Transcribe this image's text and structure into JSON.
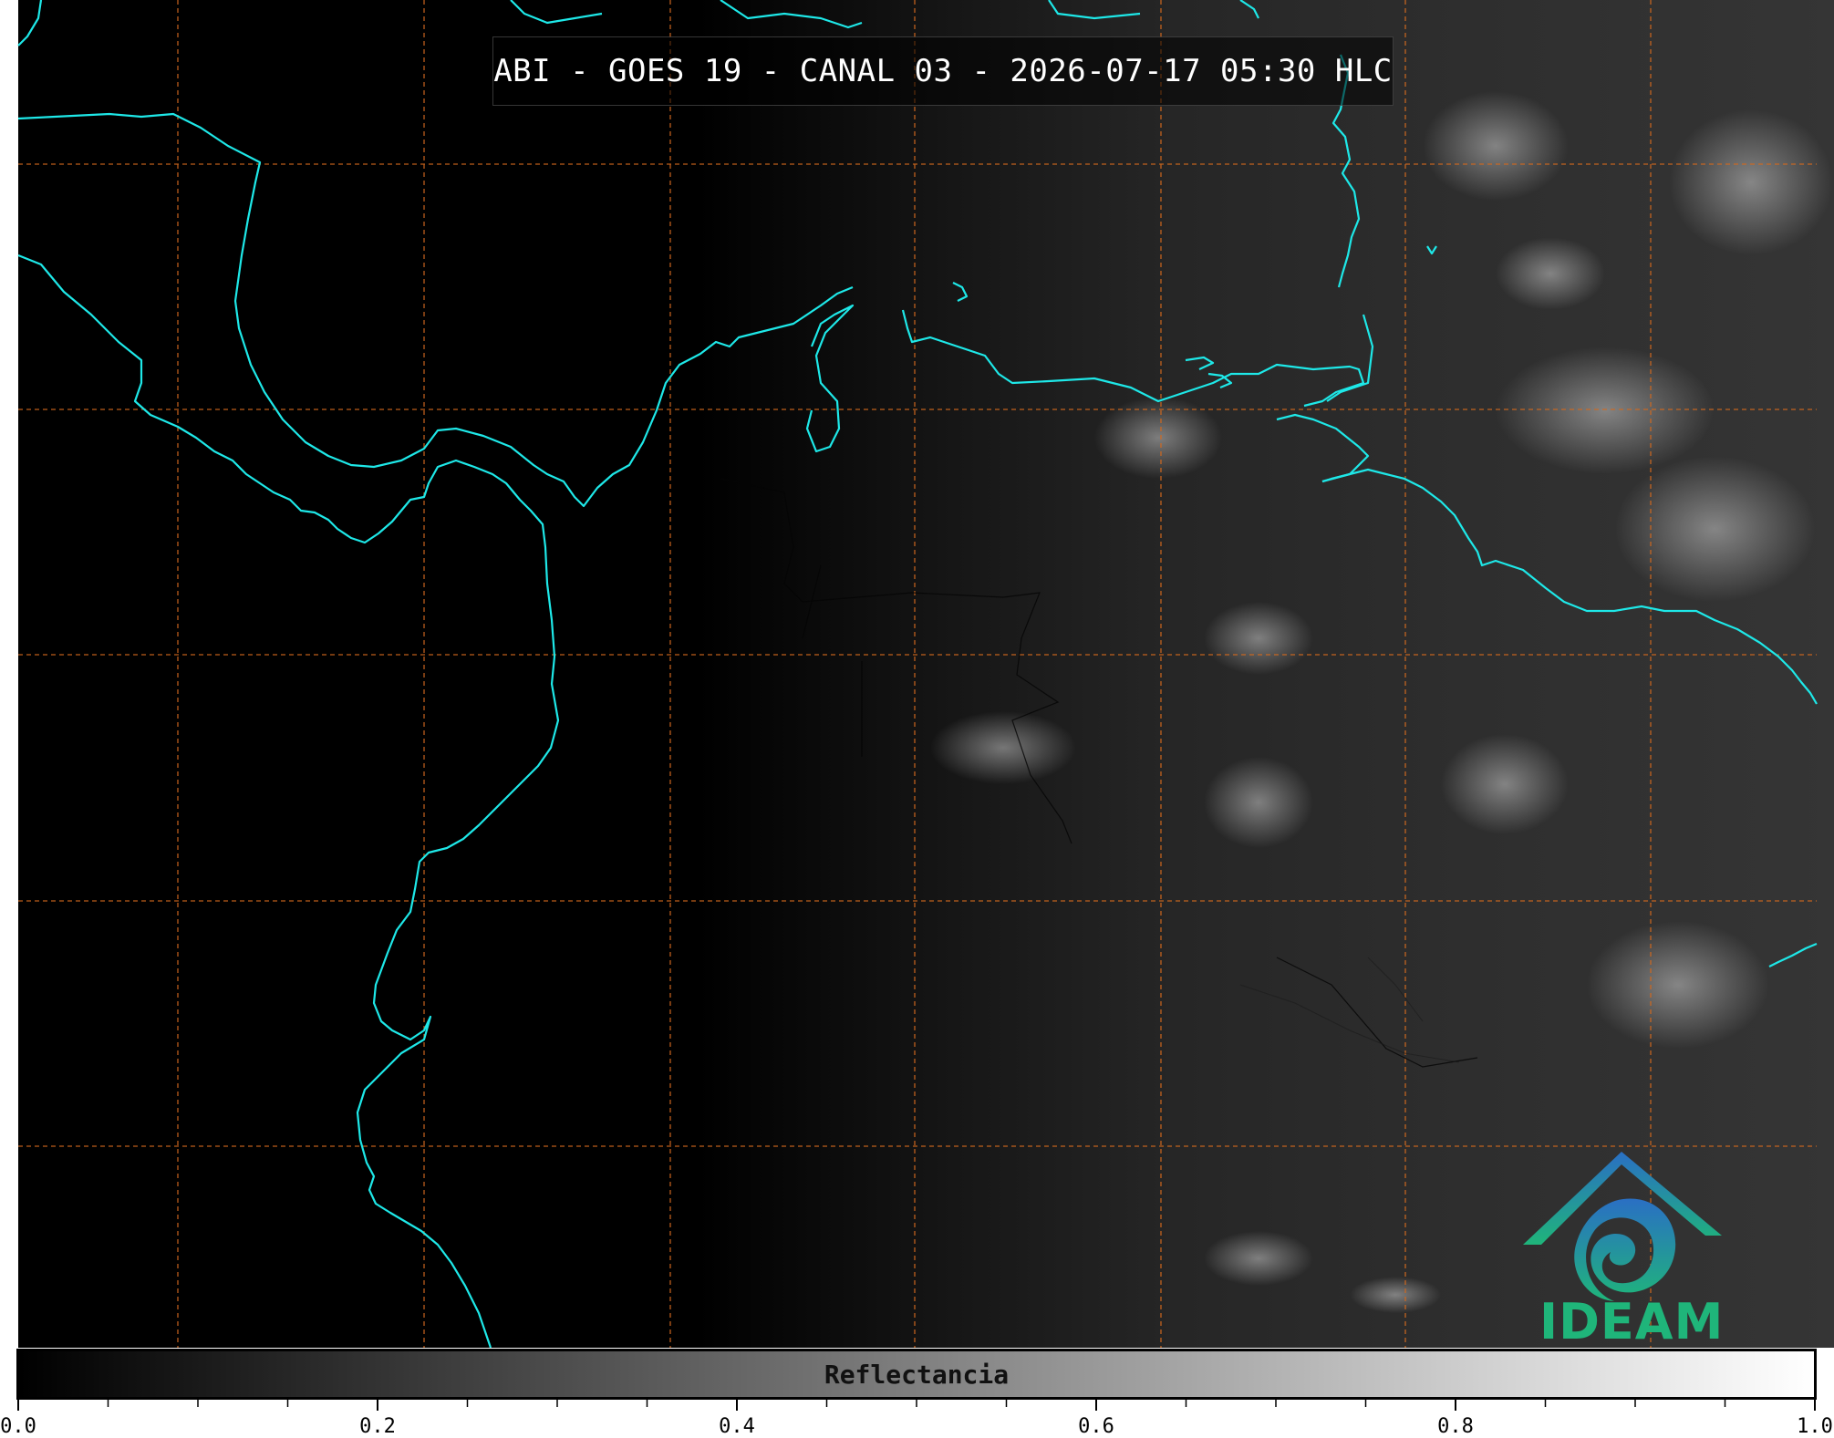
{
  "title": "ABI - GOES 19 - CANAL 03 - 2026-07-17 05:30 HLC",
  "colorbar": {
    "label": "Reflectancia",
    "range": [
      0.0,
      1.0
    ],
    "major_ticks": [
      "0.0",
      "0.2",
      "0.4",
      "0.6",
      "0.8",
      "1.0"
    ],
    "minor_tick_step": 0.05,
    "colormap": "grayscale black-to-white"
  },
  "logo": {
    "text": "IDEAM",
    "text_color": "#1fb57a",
    "mountain_color": "#2a7fc4"
  },
  "colors": {
    "coastline": "#1ee8e8",
    "gridline": "#d2691e",
    "background": "#000000"
  }
}
